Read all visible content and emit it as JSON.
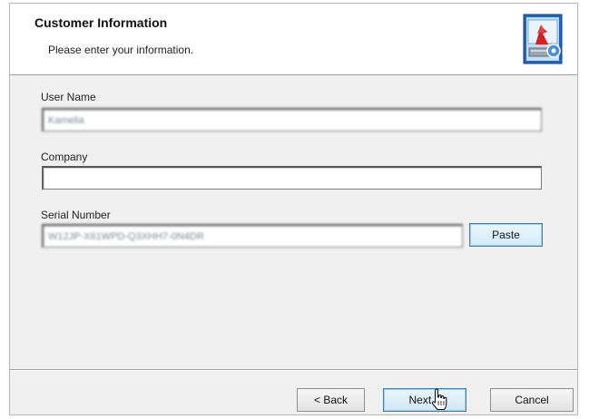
{
  "header": {
    "title": "Customer Information",
    "subtitle": "Please enter your information.",
    "icon": "installer-computer-icon"
  },
  "form": {
    "user_name": {
      "label": "User Name",
      "value": "Kamelia"
    },
    "company": {
      "label": "Company",
      "value": ""
    },
    "serial_number": {
      "label": "Serial Number",
      "value": "W12JP-X61WPD-Q3XHH7-0N4DR"
    },
    "paste_label": "Paste"
  },
  "footer": {
    "back_label": "< Back",
    "next_label": "Next >",
    "cancel_label": "Cancel"
  },
  "colors": {
    "dialog_bg": "#f0f0f0",
    "header_bg": "#ffffff",
    "focus_border": "#3c7fb1"
  }
}
